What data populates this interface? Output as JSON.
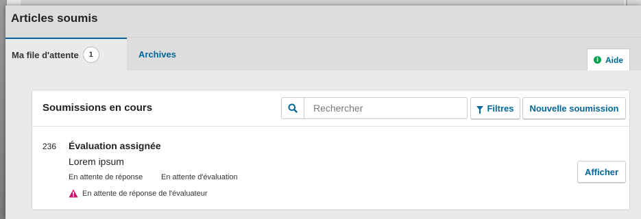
{
  "header": {
    "title": "Articles soumis"
  },
  "tabs": [
    {
      "label": "Ma file d'attente",
      "count": "1"
    },
    {
      "label": "Archives"
    }
  ],
  "help": {
    "label": "Aide"
  },
  "card": {
    "title": "Soumissions en cours",
    "search": {
      "placeholder": "Rechercher",
      "value": ""
    },
    "filters_label": "Filtres",
    "new_submission_label": "Nouvelle soumission"
  },
  "submissions": [
    {
      "id": "236",
      "title": "Évaluation assignée",
      "subtitle": "Lorem ipsum",
      "statuses": [
        "En attente de réponse",
        "En attente d'évaluation"
      ],
      "alert": "En attente de réponse de l'évaluateur",
      "view_label": "Afficher"
    }
  ],
  "colors": {
    "accent": "#006798",
    "alert": "#d00a6c",
    "info": "#00a04a"
  },
  "icons": {
    "search": "search-icon",
    "filter": "filter-icon",
    "help": "info-icon",
    "alert": "warning-icon"
  }
}
